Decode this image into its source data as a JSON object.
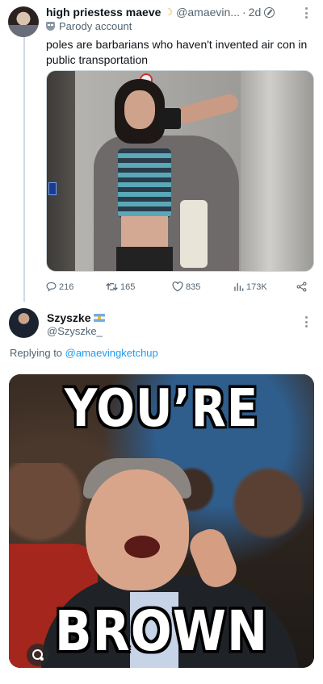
{
  "tweet1": {
    "display_name": "high priestess maeve",
    "name_emoji": "moon",
    "handle": "@amaevin...",
    "age": "2d",
    "parody_label": "Parody account",
    "text": "poles are barbarians who haven't invented air con in public transportation",
    "media_icon": "elevator-mirror-selfie",
    "actions": {
      "replies": "216",
      "retweets": "165",
      "likes": "835",
      "views": "173K"
    }
  },
  "tweet2": {
    "display_name": "Szyszke",
    "handle": "@Szyszke_",
    "replying_prefix": "Replying to",
    "replying_to": "@amaevingketchup",
    "meme": {
      "top_text": "YOU’RE",
      "bottom_text": "BROWN"
    }
  }
}
